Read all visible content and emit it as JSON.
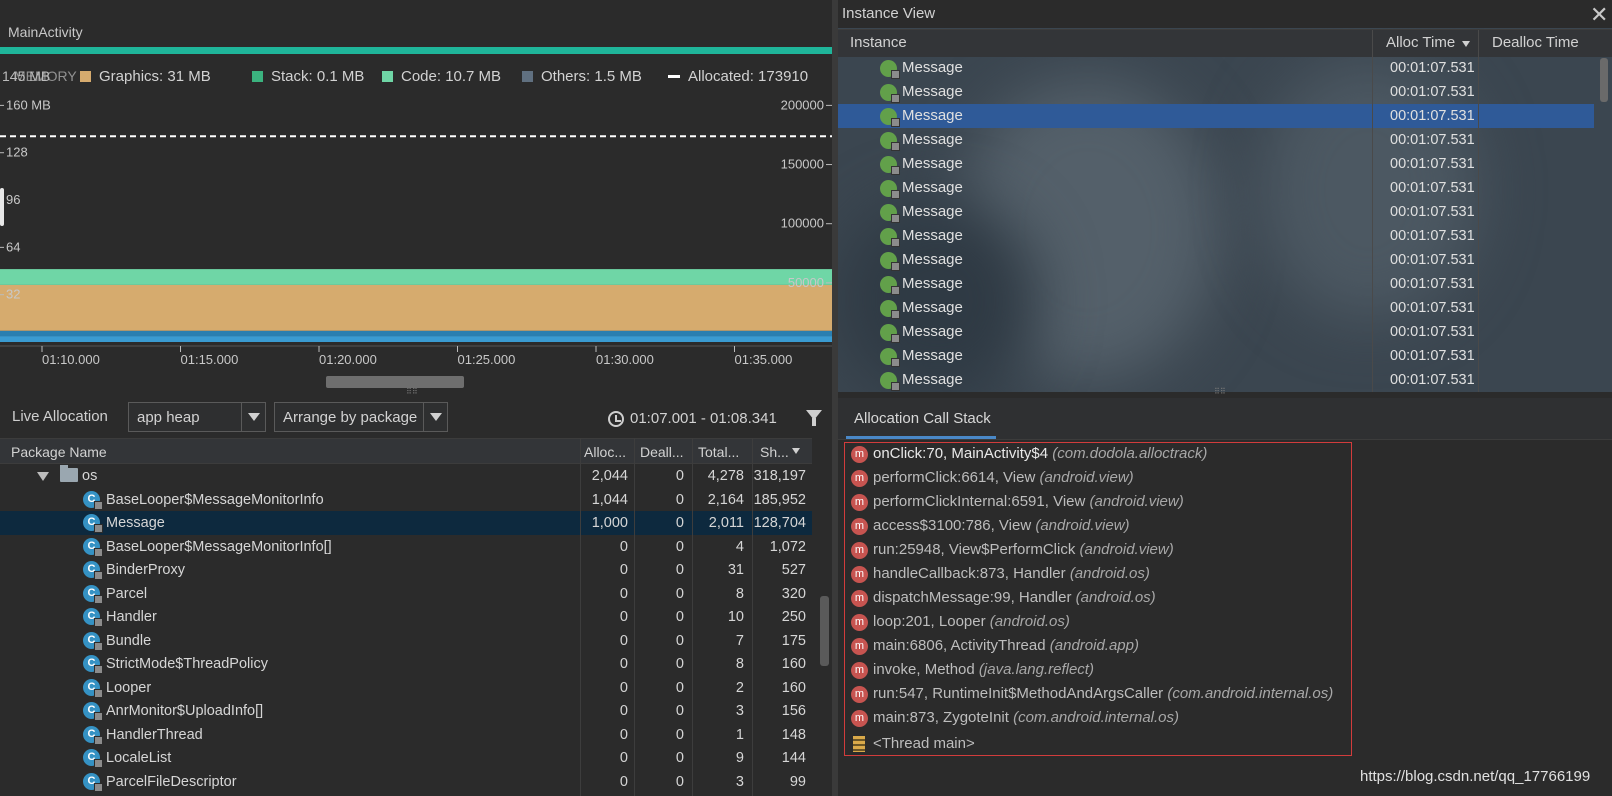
{
  "activity_label": "MainActivity",
  "legend": {
    "memory_overlap": "MEMORY",
    "items": [
      {
        "label": "Graphics: 31 MB",
        "color": "#d6ab6e"
      },
      {
        "label": "Stack: 0.1 MB",
        "color": "#3bb37f"
      },
      {
        "label": "Code: 10.7 MB",
        "color": "#6fd6a6"
      },
      {
        "label": "Others: 1.5 MB",
        "color": "#607080"
      },
      {
        "label": "Allocated: 173910",
        "color": "#ffffff"
      }
    ],
    "left_cut": "145 MB"
  },
  "chart_data": {
    "type": "area",
    "y_left_ticks": [
      "160 MB",
      "128",
      "96",
      "64",
      "32"
    ],
    "y_right_ticks": [
      "200000",
      "150000",
      "100000",
      "50000"
    ],
    "x_ticks": [
      "01:10.000",
      "01:15.000",
      "01:20.000",
      "01:25.000",
      "01:30.000",
      "01:35.000"
    ],
    "y_left_range_mb": [
      0,
      165
    ],
    "y_right_range": [
      0,
      206250
    ],
    "stacked_mb": {
      "Others": 1.5,
      "Code": 10.7,
      "Stack": 0.1,
      "Graphics": 31
    },
    "allocated_line": 173910,
    "colors": {
      "base": "#3a9bd1",
      "base_dark": "#2a7fb0",
      "graphics": "#d6ab6e",
      "code": "#6fd6a6",
      "dashed": "#ffffff"
    }
  },
  "toolbar": {
    "live_allocation": "Live Allocation",
    "heap": "app heap",
    "arrange": "Arrange by package",
    "time_range": "01:07.001 - 01:08.341"
  },
  "table": {
    "headers": [
      "Package Name",
      "Alloc...",
      "Deall...",
      "Total...",
      "Sh..."
    ],
    "rows": [
      {
        "name": "os",
        "type": "package",
        "alloc": "2,044",
        "dealloc": "0",
        "total": "4,278",
        "shallow": "318,197"
      },
      {
        "name": "BaseLooper$MessageMonitorInfo",
        "type": "class",
        "alloc": "1,044",
        "dealloc": "0",
        "total": "2,164",
        "shallow": "185,952"
      },
      {
        "name": "Message",
        "type": "class",
        "alloc": "1,000",
        "dealloc": "0",
        "total": "2,011",
        "shallow": "128,704",
        "selected": true
      },
      {
        "name": "BaseLooper$MessageMonitorInfo[]",
        "type": "class",
        "alloc": "0",
        "dealloc": "0",
        "total": "4",
        "shallow": "1,072"
      },
      {
        "name": "BinderProxy",
        "type": "class",
        "alloc": "0",
        "dealloc": "0",
        "total": "31",
        "shallow": "527"
      },
      {
        "name": "Parcel",
        "type": "class",
        "alloc": "0",
        "dealloc": "0",
        "total": "8",
        "shallow": "320"
      },
      {
        "name": "Handler",
        "type": "class",
        "alloc": "0",
        "dealloc": "0",
        "total": "10",
        "shallow": "250"
      },
      {
        "name": "Bundle",
        "type": "class",
        "alloc": "0",
        "dealloc": "0",
        "total": "7",
        "shallow": "175"
      },
      {
        "name": "StrictMode$ThreadPolicy",
        "type": "class",
        "alloc": "0",
        "dealloc": "0",
        "total": "8",
        "shallow": "160"
      },
      {
        "name": "Looper",
        "type": "class",
        "alloc": "0",
        "dealloc": "0",
        "total": "2",
        "shallow": "160"
      },
      {
        "name": "AnrMonitor$UploadInfo[]",
        "type": "class",
        "alloc": "0",
        "dealloc": "0",
        "total": "3",
        "shallow": "156"
      },
      {
        "name": "HandlerThread",
        "type": "class",
        "alloc": "0",
        "dealloc": "0",
        "total": "1",
        "shallow": "148"
      },
      {
        "name": "LocaleList",
        "type": "class",
        "alloc": "0",
        "dealloc": "0",
        "total": "9",
        "shallow": "144"
      },
      {
        "name": "ParcelFileDescriptor",
        "type": "class",
        "alloc": "0",
        "dealloc": "0",
        "total": "3",
        "shallow": "99"
      }
    ]
  },
  "instance_view": {
    "title": "Instance View",
    "headers": [
      "Instance",
      "Alloc Time",
      "Dealloc Time"
    ],
    "rows": [
      {
        "name": "Message",
        "alloc_time": "00:01:07.531"
      },
      {
        "name": "Message",
        "alloc_time": "00:01:07.531"
      },
      {
        "name": "Message",
        "alloc_time": "00:01:07.531",
        "selected": true
      },
      {
        "name": "Message",
        "alloc_time": "00:01:07.531"
      },
      {
        "name": "Message",
        "alloc_time": "00:01:07.531"
      },
      {
        "name": "Message",
        "alloc_time": "00:01:07.531"
      },
      {
        "name": "Message",
        "alloc_time": "00:01:07.531"
      },
      {
        "name": "Message",
        "alloc_time": "00:01:07.531"
      },
      {
        "name": "Message",
        "alloc_time": "00:01:07.531"
      },
      {
        "name": "Message",
        "alloc_time": "00:01:07.531"
      },
      {
        "name": "Message",
        "alloc_time": "00:01:07.531"
      },
      {
        "name": "Message",
        "alloc_time": "00:01:07.531"
      },
      {
        "name": "Message",
        "alloc_time": "00:01:07.531"
      },
      {
        "name": "Message",
        "alloc_time": "00:01:07.531"
      }
    ]
  },
  "call_stack": {
    "tab": "Allocation Call Stack",
    "frames": [
      {
        "method": "onClick:70, MainActivity$4",
        "pkg": "(com.dodola.alloctrack)"
      },
      {
        "method": "performClick:6614, View",
        "pkg": "(android.view)"
      },
      {
        "method": "performClickInternal:6591, View",
        "pkg": "(android.view)"
      },
      {
        "method": "access$3100:786, View",
        "pkg": "(android.view)"
      },
      {
        "method": "run:25948, View$PerformClick",
        "pkg": "(android.view)"
      },
      {
        "method": "handleCallback:873, Handler",
        "pkg": "(android.os)"
      },
      {
        "method": "dispatchMessage:99, Handler",
        "pkg": "(android.os)"
      },
      {
        "method": "loop:201, Looper",
        "pkg": "(android.os)"
      },
      {
        "method": "main:6806, ActivityThread",
        "pkg": "(android.app)"
      },
      {
        "method": "invoke, Method",
        "pkg": "(java.lang.reflect)"
      },
      {
        "method": "run:547, RuntimeInit$MethodAndArgsCaller",
        "pkg": "(com.android.internal.os)"
      },
      {
        "method": "main:873, ZygoteInit",
        "pkg": "(com.android.internal.os)"
      }
    ],
    "thread": "<Thread main>",
    "method_icon_letter": "m"
  },
  "class_icon_letter": "C",
  "watermark": "https://blog.csdn.net/qq_17766199"
}
